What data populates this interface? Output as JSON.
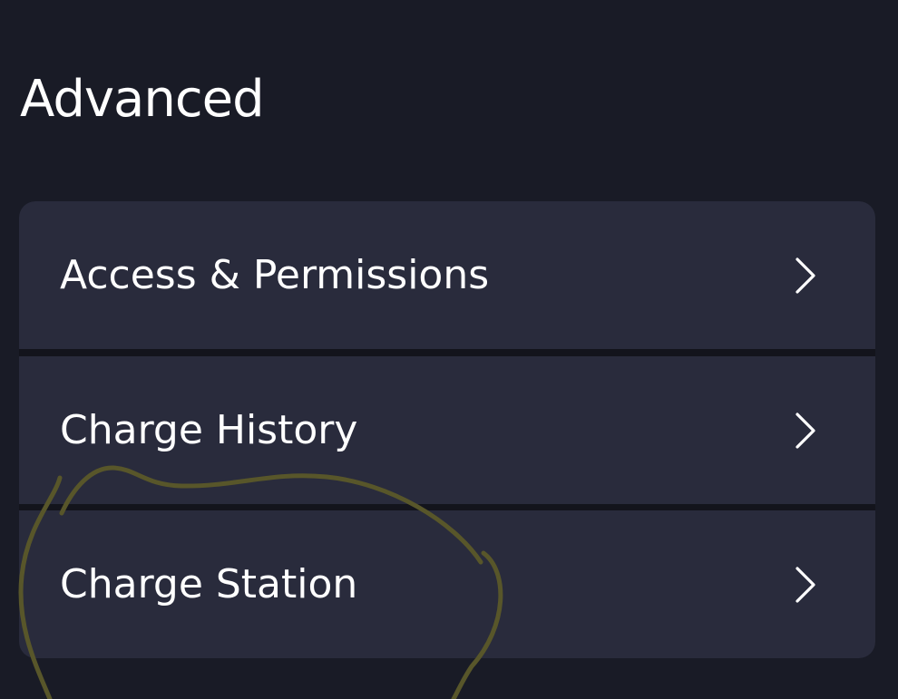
{
  "section": {
    "title": "Advanced"
  },
  "items": [
    {
      "label": "Access & Permissions",
      "icon": "chevron-right-icon"
    },
    {
      "label": "Charge History",
      "icon": "chevron-right-icon"
    },
    {
      "label": "Charge Station",
      "icon": "chevron-right-icon"
    }
  ],
  "colors": {
    "background": "#191b26",
    "item_background": "#292b3c",
    "divider": "#13141c",
    "text": "#ffffff",
    "annotation_stroke": "#58562a"
  }
}
